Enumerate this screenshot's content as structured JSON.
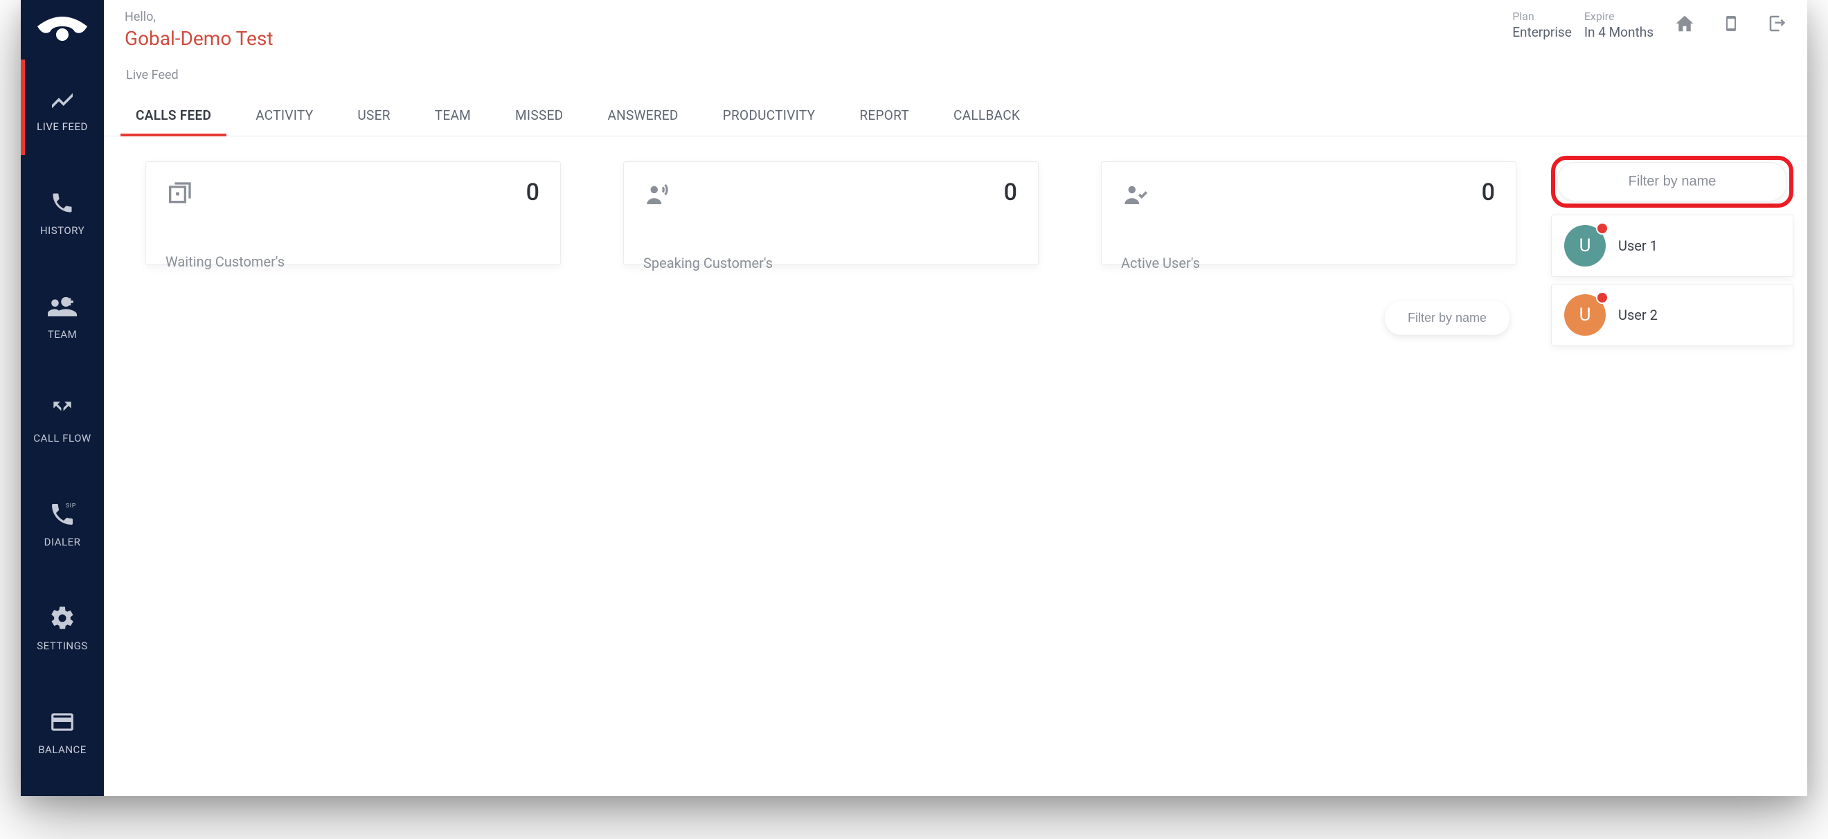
{
  "header": {
    "hello": "Hello,",
    "user_name": "Gobal-Demo Test",
    "plan_label": "Plan",
    "plan_value": "Enterprise",
    "expire_label": "Expire",
    "expire_value": "In 4 Months"
  },
  "breadcrumb": "Live Feed",
  "sidebar": {
    "items": [
      {
        "label": "LIVE FEED"
      },
      {
        "label": "HISTORY"
      },
      {
        "label": "TEAM"
      },
      {
        "label": "CALL FLOW"
      },
      {
        "label": "DIALER"
      },
      {
        "label": "SETTINGS"
      },
      {
        "label": "BALANCE"
      }
    ]
  },
  "tabs": {
    "items": [
      "CALLS FEED",
      "ACTIVITY",
      "USER",
      "TEAM",
      "MISSED",
      "ANSWERED",
      "PRODUCTIVITY",
      "REPORT",
      "CALLBACK"
    ],
    "active_index": 0
  },
  "cards": [
    {
      "label": "Waiting Customer's",
      "value": "0"
    },
    {
      "label": "Speaking Customer's",
      "value": "0"
    },
    {
      "label": "Active User's",
      "value": "0"
    }
  ],
  "filters": {
    "inner_placeholder": "Filter by name",
    "panel_placeholder": "Filter by name"
  },
  "users": [
    {
      "name": "User 1",
      "initial": "U",
      "color": "#589a95"
    },
    {
      "name": "User  2",
      "initial": "U",
      "color": "#e88a4b"
    }
  ]
}
